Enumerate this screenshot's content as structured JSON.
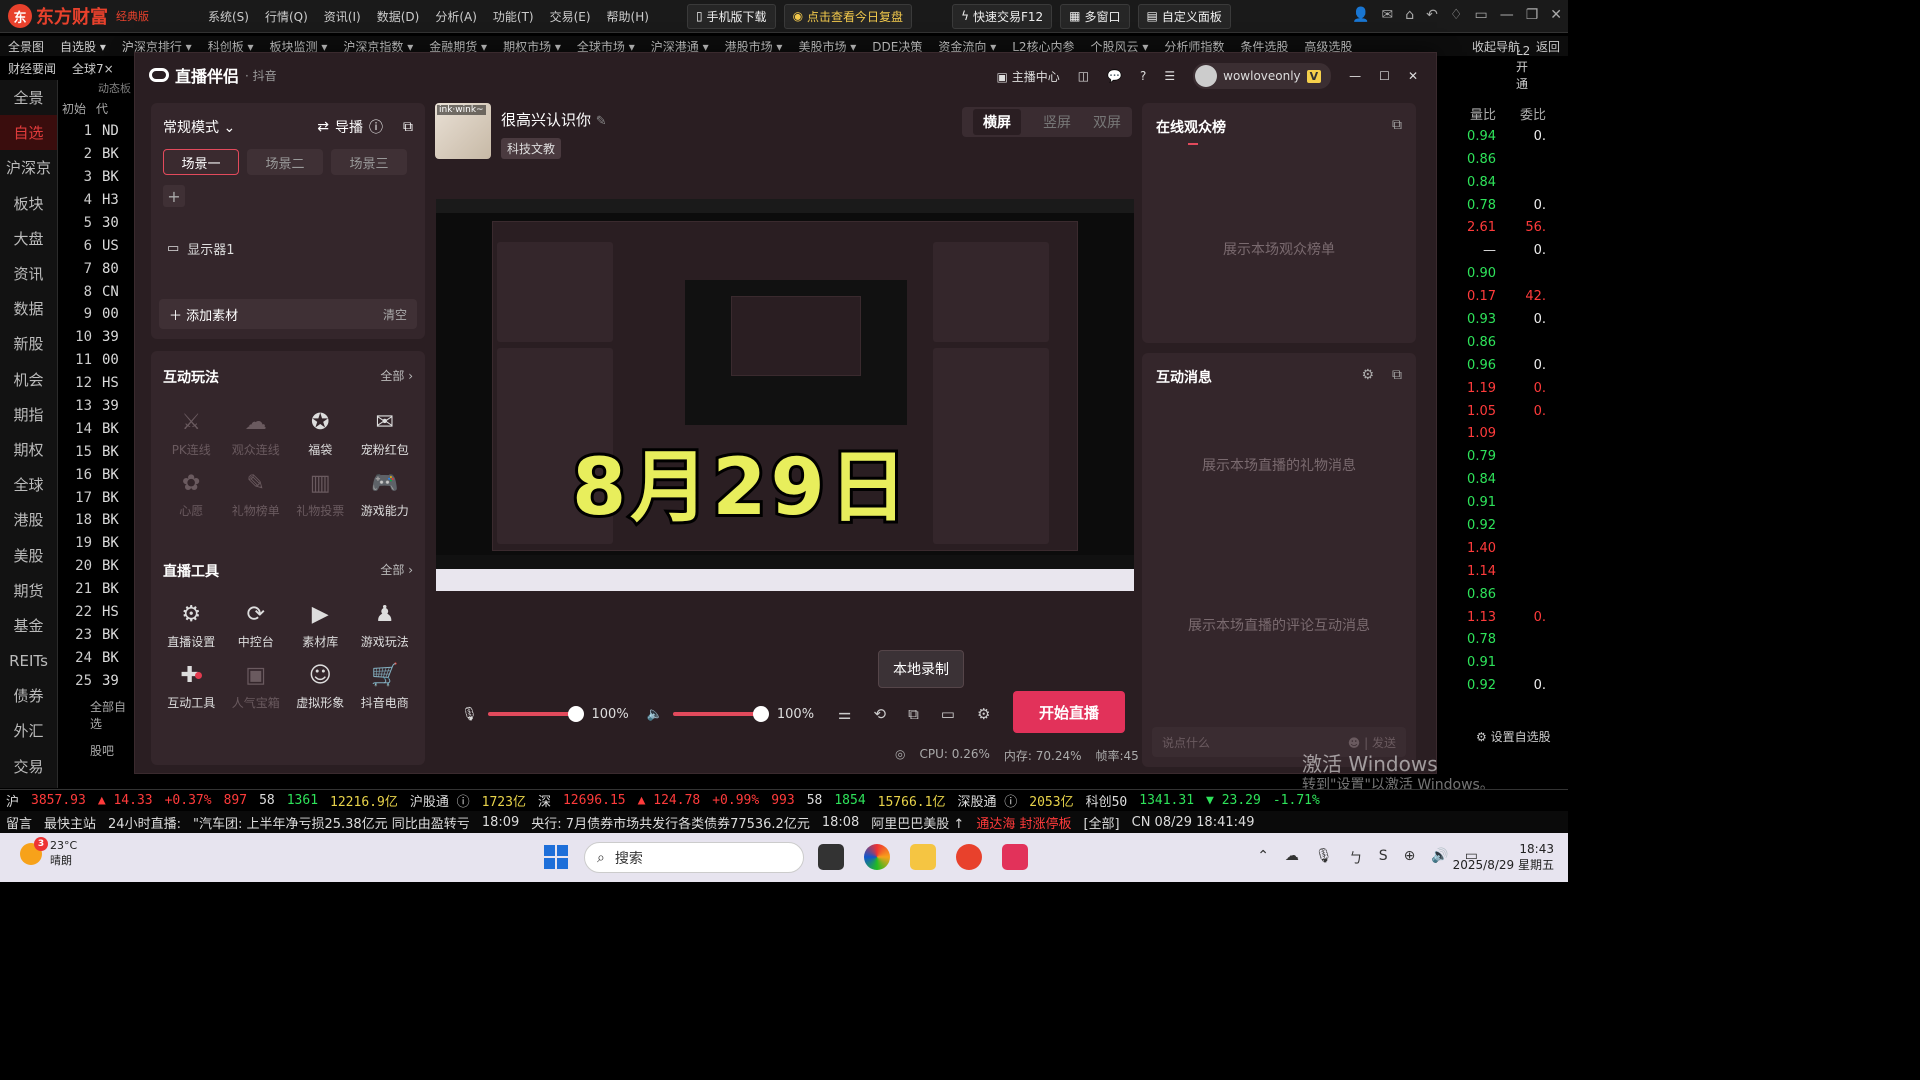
{
  "app": {
    "name": "东方财富",
    "edition": "经典版"
  },
  "topmenu": [
    "系统(S)",
    "行情(Q)",
    "资讯(I)",
    "数据(D)",
    "分析(A)",
    "功能(T)",
    "交易(E)",
    "帮助(H)"
  ],
  "topbuttons": {
    "mobile": "手机版下载",
    "review": "点击查看今日复盘",
    "quicktrade": "快速交易F12",
    "multiwin": "多窗口",
    "custom": "自定义面板"
  },
  "nav1": [
    "全景图",
    "自选股 ▾",
    "沪深京排行 ▾",
    "科创板 ▾",
    "板块监测 ▾",
    "沪深京指数 ▾",
    "金融期货 ▾",
    "期权市场 ▾",
    "全球市场 ▾",
    "沪深港通 ▾",
    "港股市场 ▾",
    "美股市场 ▾",
    "DDE决策",
    "资金流向 ▾",
    "L2核心内参",
    "个股风云 ▾",
    "分析师指数",
    "条件选股",
    "高级选股"
  ],
  "nav1_right": [
    "收起导航",
    "返回"
  ],
  "nav2": [
    "财经要闻",
    "全球7×",
    "L2开通"
  ],
  "sidebar": [
    "全景",
    "自选",
    "沪深京",
    "板块",
    "大盘",
    "资讯",
    "数据",
    "新股",
    "机会",
    "期指",
    "期权",
    "全球",
    "港股",
    "美股",
    "期货",
    "基金",
    "REITs",
    "债券",
    "外汇",
    "交易"
  ],
  "stocklist": {
    "header": [
      "初始",
      "代"
    ],
    "rows": [
      [
        "1",
        "ND"
      ],
      [
        "2",
        "BK"
      ],
      [
        "3",
        "BK"
      ],
      [
        "4",
        "H3"
      ],
      [
        "5",
        "30"
      ],
      [
        "6",
        "US"
      ],
      [
        "7",
        "80"
      ],
      [
        "8",
        "CN"
      ],
      [
        "9",
        "00"
      ],
      [
        "10",
        "39"
      ],
      [
        "11",
        "00"
      ],
      [
        "12",
        "HS"
      ],
      [
        "13",
        "39"
      ],
      [
        "14",
        "BK"
      ],
      [
        "15",
        "BK"
      ],
      [
        "16",
        "BK"
      ],
      [
        "17",
        "BK"
      ],
      [
        "18",
        "BK"
      ],
      [
        "19",
        "BK"
      ],
      [
        "20",
        "BK"
      ],
      [
        "21",
        "BK"
      ],
      [
        "22",
        "HS"
      ],
      [
        "23",
        "BK"
      ],
      [
        "24",
        "BK"
      ],
      [
        "25",
        "39"
      ]
    ],
    "footer": [
      "全部自选",
      "股吧"
    ],
    "tab": "动态板"
  },
  "rightcols": {
    "header": [
      "量比",
      "委比"
    ],
    "rows": [
      [
        "0.94",
        "0."
      ],
      [
        "0.86",
        ""
      ],
      [
        "0.84",
        ""
      ],
      [
        "0.78",
        "0."
      ],
      [
        "2.61",
        "56."
      ],
      [
        "—",
        "0."
      ],
      [
        "0.90",
        ""
      ],
      [
        "0.17",
        "42."
      ],
      [
        "0.93",
        "0."
      ],
      [
        "0.86",
        ""
      ],
      [
        "0.96",
        "0."
      ],
      [
        "1.19",
        "0."
      ],
      [
        "1.05",
        "0."
      ],
      [
        "1.09",
        ""
      ],
      [
        "0.79",
        ""
      ],
      [
        "0.84",
        ""
      ],
      [
        "0.91",
        ""
      ],
      [
        "0.92",
        ""
      ],
      [
        "1.40",
        ""
      ],
      [
        "1.14",
        ""
      ],
      [
        "0.86",
        ""
      ],
      [
        "1.13",
        "0."
      ],
      [
        "0.78",
        ""
      ],
      [
        "0.91",
        ""
      ],
      [
        "0.92",
        "0."
      ]
    ],
    "red_rows": [
      4,
      7,
      11,
      12,
      13,
      18,
      19,
      21
    ]
  },
  "live": {
    "title": "直播伴侣",
    "platform": "· 抖音",
    "topright": {
      "center": "主播中心",
      "username": "wowloveonly"
    },
    "mode": "常规模式",
    "guide": "导播",
    "scenes": [
      "场景一",
      "场景二",
      "场景三"
    ],
    "display": "显示器1",
    "add_material": "添加素材",
    "clear": "清空",
    "interactive": {
      "title": "互动玩法",
      "all": "全部 ›",
      "items": [
        [
          "PK连线",
          "dim",
          "⚔"
        ],
        [
          "观众连线",
          "dim",
          "☁"
        ],
        [
          "福袋",
          "on",
          "✪"
        ],
        [
          "宠粉红包",
          "on",
          "✉"
        ],
        [
          "心愿",
          "dim",
          "✿"
        ],
        [
          "礼物榜单",
          "dim",
          "✎"
        ],
        [
          "礼物投票",
          "dim",
          "▥"
        ],
        [
          "游戏能力",
          "on",
          "🎮"
        ]
      ]
    },
    "tools": {
      "title": "直播工具",
      "all": "全部 ›",
      "items": [
        [
          "直播设置",
          "on",
          "⚙"
        ],
        [
          "中控台",
          "on",
          "⟳"
        ],
        [
          "素材库",
          "on",
          "▶"
        ],
        [
          "游戏玩法",
          "on",
          "♟"
        ],
        [
          "互动工具",
          "on",
          "✚"
        ],
        [
          "人气宝箱",
          "dim",
          "▣"
        ],
        [
          "虚拟形象",
          "on",
          "☺"
        ],
        [
          "抖音电商",
          "on",
          "🛒"
        ]
      ]
    },
    "streamer": {
      "name": "很高兴认识你",
      "tag": "科技文教",
      "pic_text": "ink·wink~"
    },
    "orient": [
      "横屏",
      "竖屏",
      "双屏"
    ],
    "overlay_date": "8月29日",
    "tooltip": "本地录制",
    "mic_volume": "100%",
    "speaker_volume": "100%",
    "start": "开始直播",
    "stats": {
      "cpu": "CPU: 0.26%",
      "mem": "内存: 70.24%",
      "fps": "帧率:45"
    },
    "audience": {
      "title": "在线观众榜",
      "empty": "展示本场观众榜单"
    },
    "messages": {
      "title": "互动消息",
      "gift_empty": "展示本场直播的礼物消息",
      "comment_empty": "展示本场直播的评论互动消息",
      "input_placeholder": "说点什么",
      "send": "发送"
    }
  },
  "watermark": {
    "line1": "激活 Windows",
    "line2": "转到\"设置\"以激活 Windows。"
  },
  "rightlink": "设置自选股",
  "indexbar": [
    [
      "沪",
      "wht"
    ],
    [
      "3857.93",
      "red"
    ],
    [
      "▲ 14.33",
      "red"
    ],
    [
      "+0.37%",
      "red"
    ],
    [
      "897",
      "red"
    ],
    [
      "58",
      "wht"
    ],
    [
      "1361",
      "grn"
    ],
    [
      "12216.9亿",
      "yel"
    ],
    [
      "沪股通 ⓘ",
      "wht"
    ],
    [
      "1723亿",
      "yel"
    ],
    [
      "深",
      "wht"
    ],
    [
      "12696.15",
      "red"
    ],
    [
      "▲ 124.78",
      "red"
    ],
    [
      "+0.99%",
      "red"
    ],
    [
      "993",
      "red"
    ],
    [
      "58",
      "wht"
    ],
    [
      "1854",
      "grn"
    ],
    [
      "15766.1亿",
      "yel"
    ],
    [
      "深股通 ⓘ",
      "wht"
    ],
    [
      "2053亿",
      "yel"
    ],
    [
      "科创50",
      "wht"
    ],
    [
      "1341.31",
      "grn"
    ],
    [
      "▼ 23.29",
      "grn"
    ],
    [
      "-1.71%",
      "grn"
    ]
  ],
  "newsbar": [
    [
      "留言",
      "wht"
    ],
    [
      "最快主站",
      "wht"
    ],
    [
      "24小时直播:",
      "wht"
    ],
    [
      "\"汽车团: 上半年净亏损25.38亿元 同比由盈转亏",
      "wht"
    ],
    [
      "18:09",
      "wht"
    ],
    [
      "央行: 7月债券市场共发行各类债券77536.2亿元",
      "wht"
    ],
    [
      "18:08",
      "wht"
    ],
    [
      "阿里巴巴美股 ↑",
      "wht"
    ],
    [
      "通达海 封涨停板",
      "red"
    ],
    [
      "[全部]",
      "wht"
    ],
    [
      "CN 08/29 18:41:49",
      "wht"
    ]
  ],
  "taskbar": {
    "temp": "23°C",
    "weather": "晴朗",
    "badge": "3",
    "search": "搜索",
    "time": "18:43",
    "date": "2025/8/29 星期五"
  }
}
